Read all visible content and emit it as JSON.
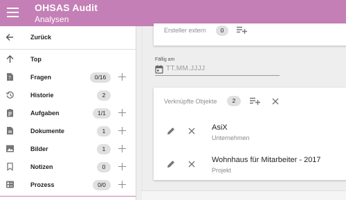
{
  "header": {
    "title": "OHSAS Audit",
    "subtitle": "Analysen"
  },
  "sidebar": {
    "back_label": "Zurück",
    "items": [
      {
        "label": "Top",
        "badge": "",
        "icon": "arrow-up-icon"
      },
      {
        "label": "Fragen",
        "badge": "0/16",
        "icon": "question-file-icon"
      },
      {
        "label": "Historie",
        "badge": "2",
        "icon": "history-icon"
      },
      {
        "label": "Aufgaben",
        "badge": "1/1",
        "icon": "clipboard-icon"
      },
      {
        "label": "Dokumente",
        "badge": "1",
        "icon": "document-icon"
      },
      {
        "label": "Bilder",
        "badge": "1",
        "icon": "image-icon"
      },
      {
        "label": "Notizen",
        "badge": "0",
        "icon": "bookmark-icon"
      },
      {
        "label": "Prozess",
        "badge": "0/0",
        "icon": "process-icon"
      }
    ]
  },
  "main": {
    "external_creator_label": "Ersteller extern",
    "external_creator_count": "0",
    "due_label": "Fällig am",
    "due_placeholder": "TT.MM.JJJJ",
    "linked_label": "Verknüpfte Objekte",
    "linked_count": "2",
    "objects": [
      {
        "name": "AsiX",
        "type": "Unternehmen"
      },
      {
        "name": "Wohnhaus für Mitarbeiter - 2017",
        "type": "Projekt"
      }
    ]
  },
  "colors": {
    "accent": "#c47fb6",
    "chip": "#e0e0e0",
    "icon": "#757575"
  }
}
